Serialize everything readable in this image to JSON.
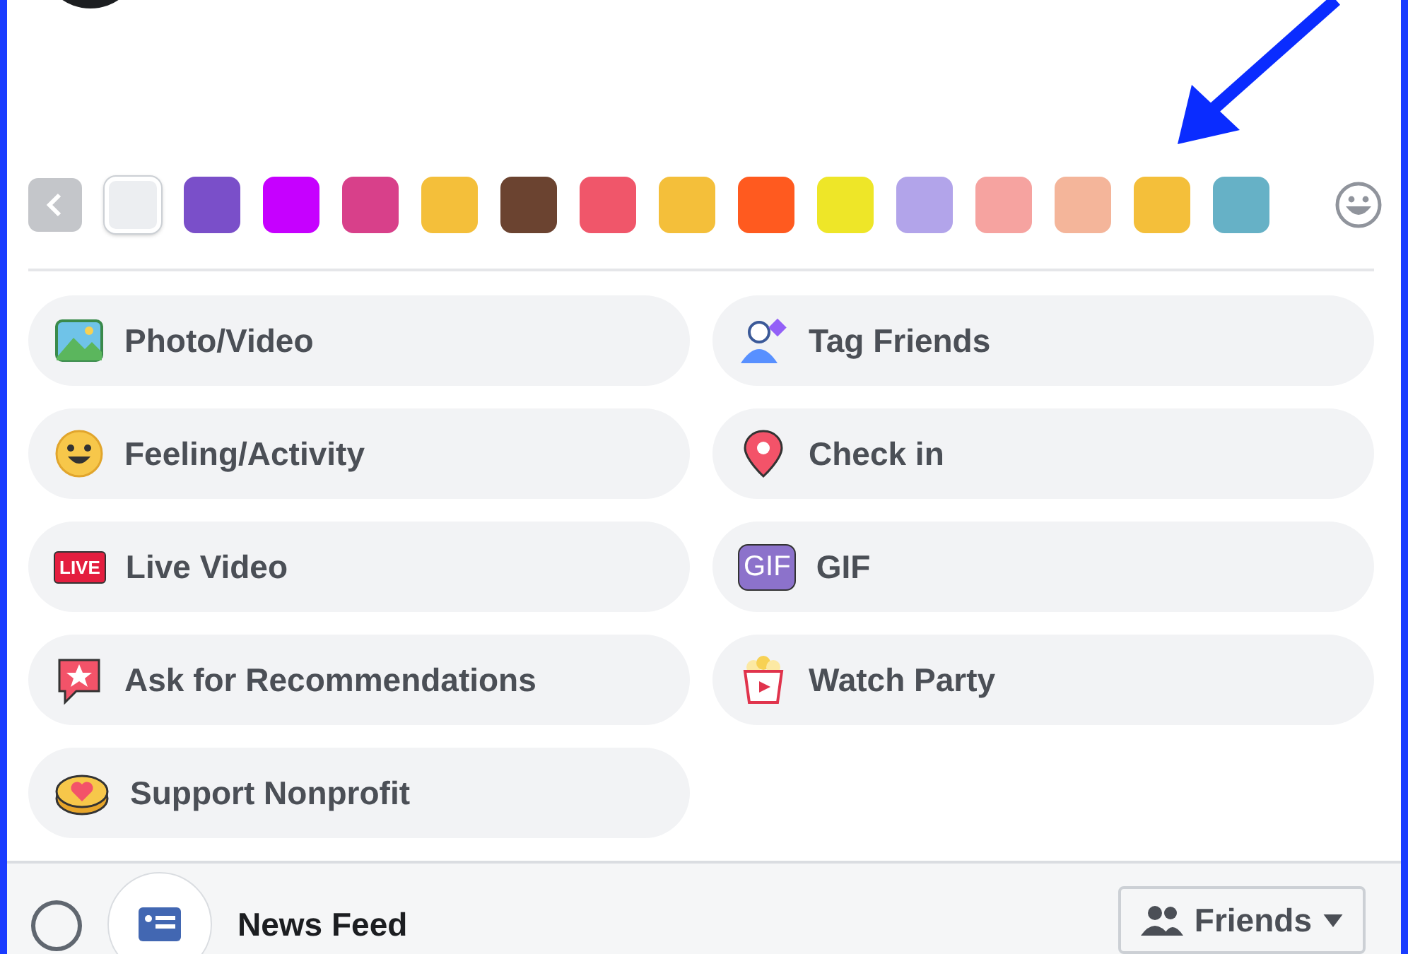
{
  "backgrounds": [
    {
      "color": "#eceef1",
      "selected": true
    },
    {
      "color": "#7a4fc9",
      "selected": false
    },
    {
      "color": "#c600ff",
      "selected": false
    },
    {
      "color": "#d8408a",
      "selected": false
    },
    {
      "color": "#f4bf3a",
      "selected": false
    },
    {
      "color": "#6b4330",
      "selected": false
    },
    {
      "color": "#f0566a",
      "selected": false
    },
    {
      "color": "#f4bf3a",
      "selected": false
    },
    {
      "color": "#ff5a1f",
      "selected": false
    },
    {
      "color": "#eee628",
      "selected": false
    },
    {
      "color": "#b2a4ea",
      "selected": false
    },
    {
      "color": "#f6a3a0",
      "selected": false
    },
    {
      "color": "#f4b59a",
      "selected": false
    },
    {
      "color": "#f4bf3a",
      "selected": false
    },
    {
      "color": "#66b1c6",
      "selected": false
    }
  ],
  "options": [
    {
      "kind": "photo",
      "label": "Photo/Video"
    },
    {
      "kind": "tag",
      "label": "Tag Friends"
    },
    {
      "kind": "feeling",
      "label": "Feeling/Activity"
    },
    {
      "kind": "checkin",
      "label": "Check in"
    },
    {
      "kind": "live",
      "label": "Live Video",
      "badge": "LIVE"
    },
    {
      "kind": "gif",
      "label": "GIF",
      "badge": "GIF"
    },
    {
      "kind": "recommend",
      "label": "Ask for Recommendations"
    },
    {
      "kind": "watch",
      "label": "Watch Party"
    },
    {
      "kind": "nonprofit",
      "label": "Support Nonprofit"
    }
  ],
  "share": {
    "audience_selected": false,
    "destination": "News Feed",
    "privacy": "Friends"
  }
}
